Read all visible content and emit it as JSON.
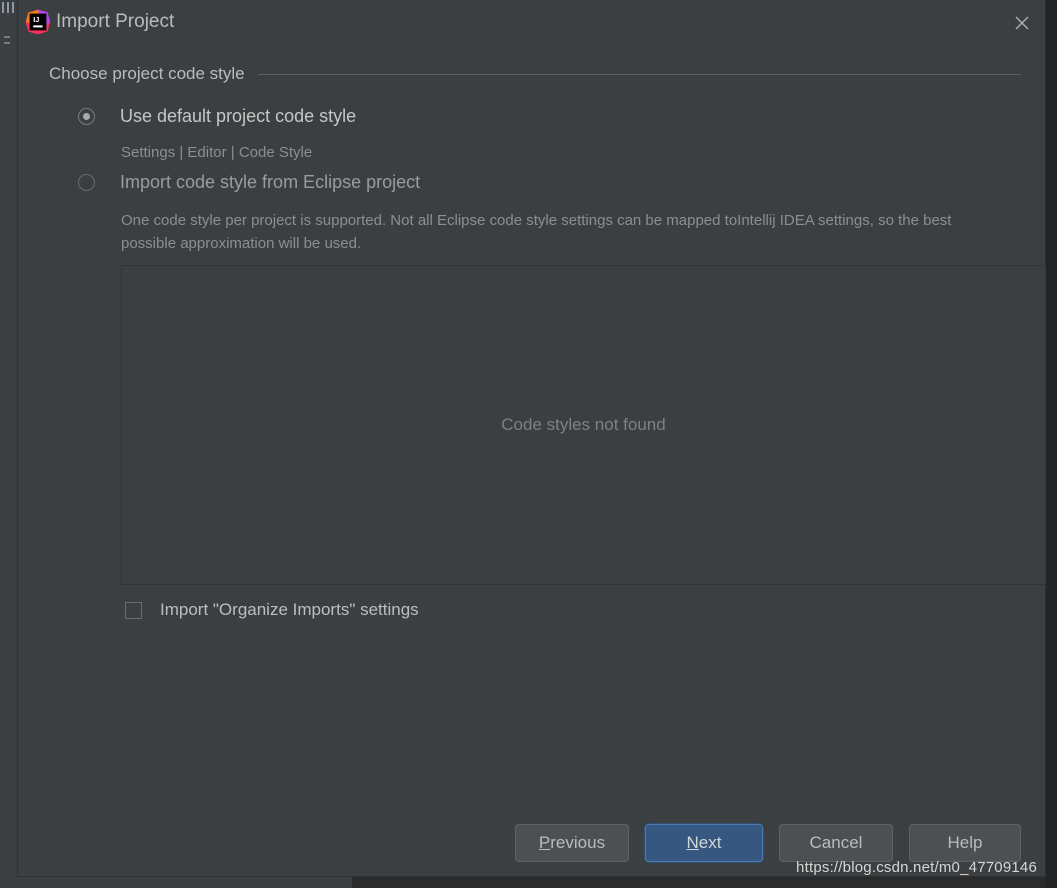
{
  "window": {
    "title": "Import Project",
    "app_icon": "intellij-idea-icon",
    "close_icon": "close-icon",
    "background": "#3c3f41",
    "accent": "#365880"
  },
  "group": {
    "header": "Choose project code style"
  },
  "options": [
    {
      "id": "use-default",
      "label": "Use default project code style",
      "selected": true,
      "note": "Settings | Editor | Code Style"
    },
    {
      "id": "import-eclipse",
      "label": "Import code style from Eclipse project",
      "selected": false,
      "note": "One code style per project is supported. Not all Eclipse code style settings can be mapped toIntellij IDEA settings, so the best possible approximation will be used."
    }
  ],
  "list_panel": {
    "empty_text": "Code styles not found"
  },
  "checkbox": {
    "label": "Import \"Organize Imports\" settings",
    "checked": false
  },
  "buttons": {
    "previous": {
      "prefix": "",
      "mnemonic": "P",
      "suffix": "revious"
    },
    "next": {
      "prefix": "",
      "mnemonic": "N",
      "suffix": "ext",
      "primary": true
    },
    "cancel": {
      "label": "Cancel"
    },
    "help": {
      "label": "Help"
    }
  },
  "watermark": {
    "text": "https://blog.csdn.net/m0_47709146"
  }
}
